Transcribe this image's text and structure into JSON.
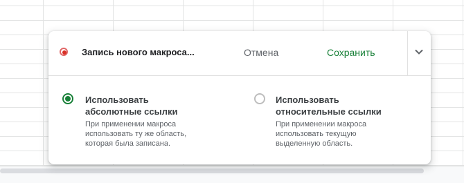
{
  "macro_panel": {
    "recording_title": "Запись нового макроса...",
    "cancel_label": "Отмена",
    "save_label": "Сохранить",
    "expand_icon": "chevron-down-icon",
    "options": [
      {
        "title_line1": "Использовать",
        "title_line2": "абсолютные ссылки",
        "desc_line1": "При применении макроса",
        "desc_line2": "использовать ту же область,",
        "desc_line3": "которая была записана.",
        "selected": true
      },
      {
        "title_line1": "Использовать",
        "title_line2": "относительные ссылки",
        "desc_line1": "При применении макроса",
        "desc_line2": "использовать текущую",
        "desc_line3": "выделенную область.",
        "selected": false
      }
    ]
  },
  "colors": {
    "accent_green": "#188038",
    "record_red": "#d93025"
  }
}
